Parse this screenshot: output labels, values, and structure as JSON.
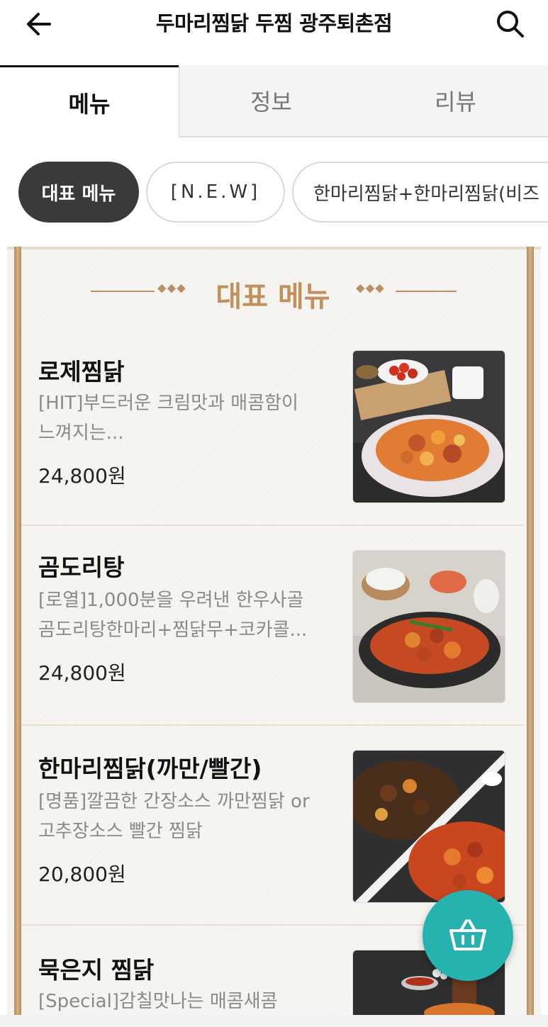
{
  "header": {
    "title": "두마리찜닭 두찜 광주퇴촌점",
    "back_icon": "arrow-left-icon",
    "search_icon": "search-icon"
  },
  "tabs": [
    {
      "label": "메뉴",
      "active": true
    },
    {
      "label": "정보",
      "active": false
    },
    {
      "label": "리뷰",
      "active": false
    }
  ],
  "chips": [
    {
      "label": "대표 메뉴",
      "active": true
    },
    {
      "label": "[N.E.W]",
      "active": false
    },
    {
      "label": "한마리찜닭+한마리찜닭(비즈",
      "active": false
    }
  ],
  "section": {
    "title": "대표 메뉴",
    "deco_left": "⬥⬥⬥",
    "deco_right": "⬥⬥⬥"
  },
  "menu_items": [
    {
      "name": "로제찜닭",
      "desc_line1": "[HIT]부드러운 크림맛과 매콤함이",
      "desc_line2": "느껴지는...",
      "price": "24,800원"
    },
    {
      "name": "곰도리탕",
      "desc_line1": "[로열]1,000분을 우려낸 한우사골",
      "desc_line2": "곰도리탕한마리+찜닭무+코카콜...",
      "price": "24,800원"
    },
    {
      "name": "한마리찜닭(까만/빨간)",
      "desc_line1": "[명품]깔끔한 간장소스 까만찜닭 or",
      "desc_line2": "고추장소스 빨간 찜닭",
      "price": "20,800원"
    },
    {
      "name": "묵은지 찜닭",
      "desc_line1": "[Special]감칠맛나는 매콤새콤",
      "desc_line2": "",
      "price": ""
    }
  ],
  "fab": {
    "icon": "shopping-basket-icon"
  },
  "colors": {
    "accent_gold": "#c2905a",
    "fab_teal": "#26b3b0",
    "chip_active": "#3a3a3a"
  }
}
